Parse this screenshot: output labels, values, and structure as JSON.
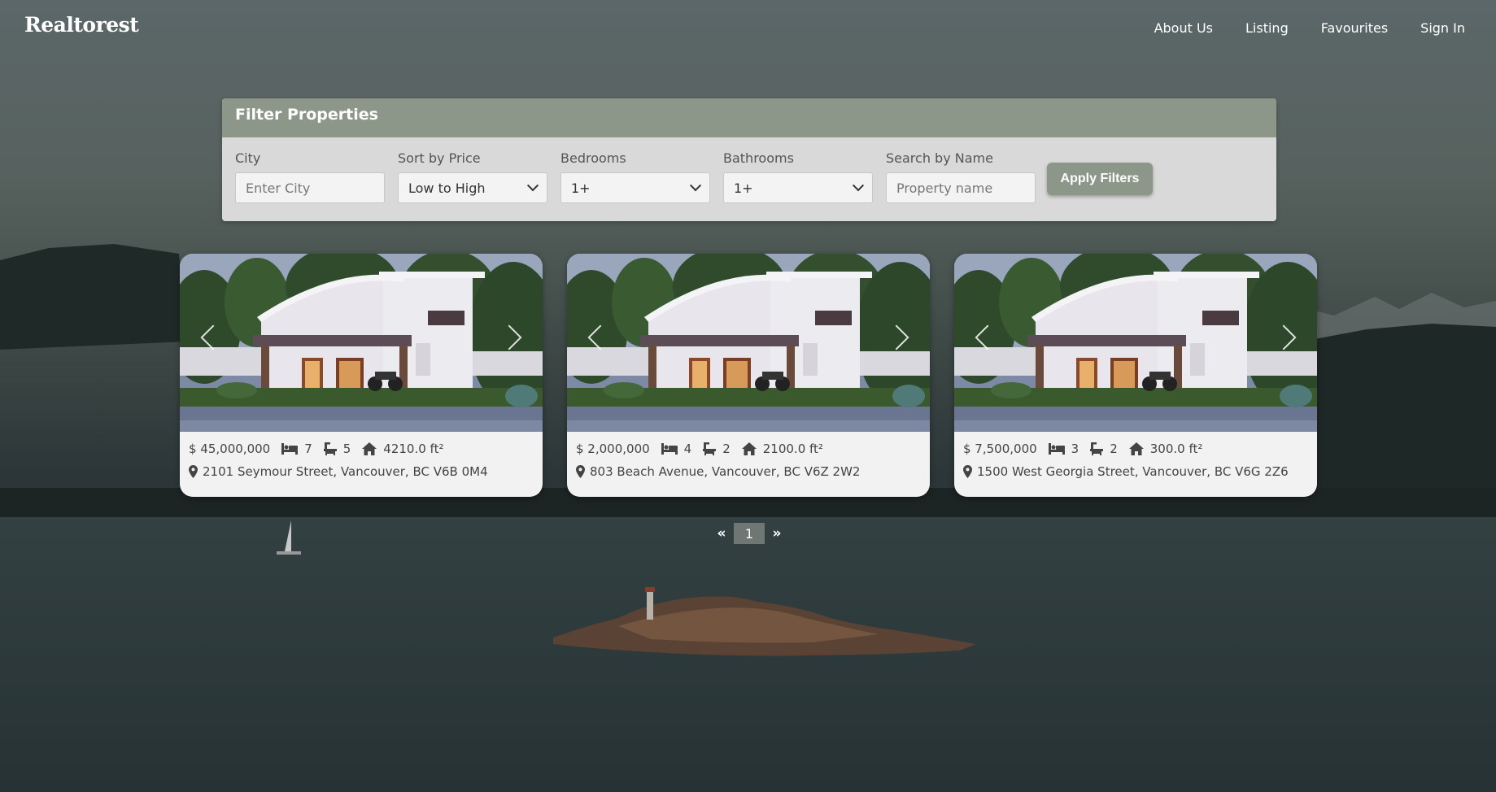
{
  "app": {
    "brand": "Realtorest"
  },
  "nav": {
    "links": [
      "About Us",
      "Listing",
      "Favourites",
      "Sign In"
    ]
  },
  "filter": {
    "title": "Filter Properties",
    "city": {
      "label": "City",
      "placeholder": "Enter City"
    },
    "sort": {
      "label": "Sort by Price",
      "value": "Low to High"
    },
    "bedrooms": {
      "label": "Bedrooms",
      "value": "1+"
    },
    "bathrooms": {
      "label": "Bathrooms",
      "value": "1+"
    },
    "name": {
      "label": "Search by Name",
      "placeholder": "Property name"
    },
    "apply_label": "Apply Filters"
  },
  "listings": [
    {
      "price": "$ 45,000,000",
      "beds": "7",
      "baths": "5",
      "area": "4210.0 ft²",
      "address": "2101 Seymour Street, Vancouver, BC V6B 0M4"
    },
    {
      "price": "$ 2,000,000",
      "beds": "4",
      "baths": "2",
      "area": "2100.0 ft²",
      "address": "803 Beach Avenue, Vancouver, BC V6Z 2W2"
    },
    {
      "price": "$ 7,500,000",
      "beds": "3",
      "baths": "2",
      "area": "300.0 ft²",
      "address": "1500 West Georgia Street, Vancouver, BC V6G 2Z6"
    }
  ],
  "pagination": {
    "prev": "«",
    "current": "1",
    "next": "»"
  },
  "icons": {
    "bed": "bed-icon",
    "bath": "bath-icon",
    "area": "home-icon",
    "location": "location-pin-icon"
  }
}
